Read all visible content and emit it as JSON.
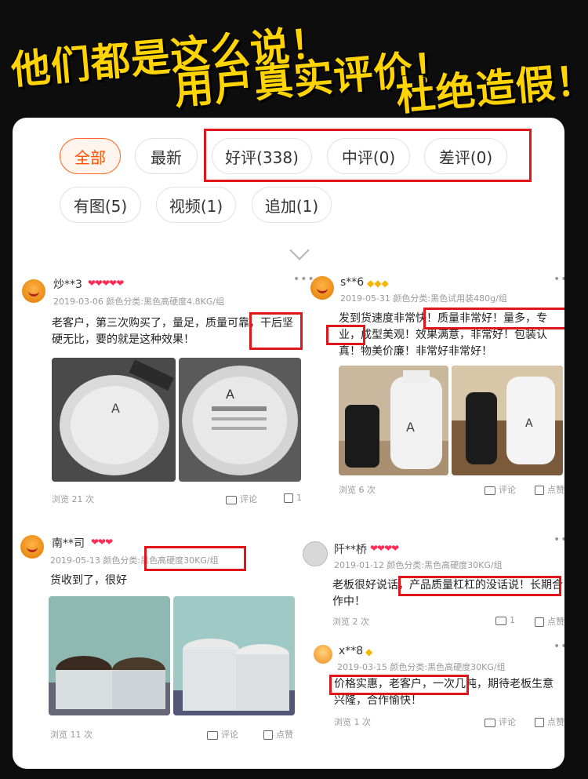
{
  "headline": {
    "line1": "他们都是这么说！",
    "line2": "用户真实评价！",
    "line3": "杜绝造假！"
  },
  "filters": {
    "row1": [
      "全部",
      "最新",
      "好评(338)",
      "中评(0)",
      "差评(0)"
    ],
    "row2": [
      "有图(5)",
      "视频(1)",
      "追加(1)"
    ]
  },
  "reviews": [
    {
      "name": "炒**3",
      "badge": "❤❤❤❤❤",
      "meta": "2019-03-06 颜色分类:黑色高硬度4.8KG/组",
      "text": "老客户，第三次购买了，量足，质量可靠，干后坚硬无比，要的就是这种效果！",
      "footer": {
        "views": "浏览 21 次",
        "comment": "评论",
        "likes": "1"
      }
    },
    {
      "name": "s**6",
      "badge": "◆◆◆",
      "meta": "2019-05-31 颜色分类:黑色试用装480g/组",
      "text": "发到货速度非常快！质量非常好！量多，专业，成型美观！效果满意，非常好！包装认真！物美价廉！非常好非常好！",
      "footer": {
        "views": "浏览 6 次",
        "comment": "评论",
        "likes": "点赞"
      }
    },
    {
      "name": "南**司",
      "badge": "❤❤❤",
      "meta": "2019-05-13 颜色分类:黑色高硬度30KG/组",
      "text": "货收到了，很好",
      "footer": {
        "views": "浏览 11 次",
        "comment": "评论",
        "likes": "点赞"
      }
    },
    {
      "name": "阡**桥",
      "badge": "❤❤❤❤",
      "meta": "2019-01-12 颜色分类:黑色高硬度30KG/组",
      "text": "老板很好说话，产品质量杠杠的没话说！长期合作中！",
      "footer": {
        "views": "浏览 2 次",
        "comment": "1",
        "likes": "点赞"
      }
    },
    {
      "name": "x**8",
      "badge": "◆",
      "meta": "2019-03-15 颜色分类:黑色高硬度30KG/组",
      "text": "价格实惠，老客户，一次几吨，期待老板生意兴隆，合作愉快！",
      "footer": {
        "views": "浏览 1 次",
        "comment": "评论",
        "likes": "点赞"
      }
    }
  ],
  "colors": {
    "accent": "#ff5000",
    "highlight_box": "#e0161b",
    "headline": "#ffd400"
  }
}
